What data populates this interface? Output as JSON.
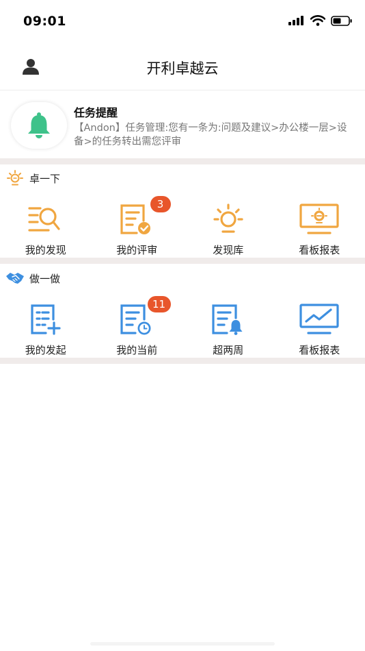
{
  "status_bar": {
    "time": "09:01"
  },
  "header": {
    "title": "开利卓越云"
  },
  "notice": {
    "title": "任务提醒",
    "body": "【Andon】任务管理:您有一条为:问题及建议>办公楼一层>设备>的任务转出需您评审"
  },
  "section_1": {
    "title": "卓一下",
    "icon": "lightbulb-icon",
    "accent": "#f0a640",
    "items": [
      {
        "label": "我的发现",
        "icon": "search-list-icon",
        "badge": ""
      },
      {
        "label": "我的评审",
        "icon": "review-check-icon",
        "badge": "3"
      },
      {
        "label": "发现库",
        "icon": "lightbulb-icon",
        "badge": ""
      },
      {
        "label": "看板报表",
        "icon": "monitor-lightbulb-icon",
        "badge": ""
      }
    ]
  },
  "section_2": {
    "title": "做一做",
    "icon": "handshake-icon",
    "accent": "#3d8fe0",
    "items": [
      {
        "label": "我的发起",
        "icon": "doc-add-icon",
        "badge": ""
      },
      {
        "label": "我的当前",
        "icon": "doc-clock-icon",
        "badge": "11"
      },
      {
        "label": "超两周",
        "icon": "doc-bell-icon",
        "badge": ""
      },
      {
        "label": "看板报表",
        "icon": "monitor-chart-icon",
        "badge": ""
      }
    ]
  },
  "colors": {
    "badge": "#e8562b",
    "bell": "#3ec28a",
    "divider": "#f0ebea"
  }
}
